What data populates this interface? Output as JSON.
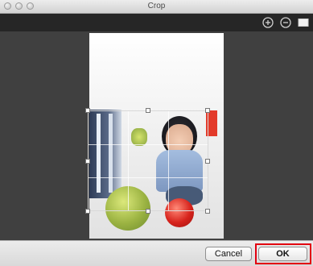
{
  "window": {
    "title": "Crop"
  },
  "toolbar": {
    "zoom_in_icon": "plus-circle-icon",
    "zoom_out_icon": "minus-circle-icon",
    "fit_icon": "rectangle-icon"
  },
  "footer": {
    "cancel_label": "Cancel",
    "ok_label": "OK"
  },
  "colors": {
    "highlight": "#e20010",
    "toolbar_bg": "#262626",
    "canvas_bg": "#404040"
  }
}
